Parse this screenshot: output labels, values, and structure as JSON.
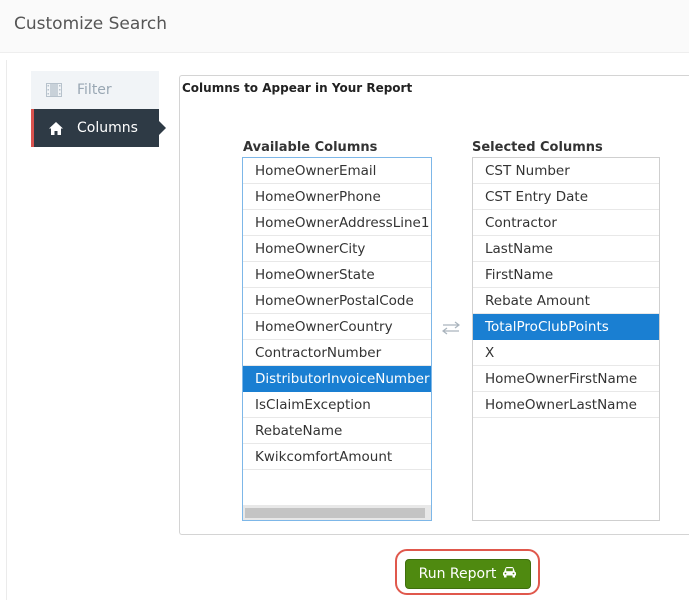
{
  "header": {
    "title": "Customize Search"
  },
  "nav": {
    "items": [
      {
        "label": "Filter",
        "icon": "film-icon",
        "active": false
      },
      {
        "label": "Columns",
        "icon": "home-icon",
        "active": true
      }
    ]
  },
  "panel": {
    "title": "Columns to Appear in Your Report",
    "available": {
      "label": "Available Columns",
      "items": [
        "HomeOwnerEmail",
        "HomeOwnerPhone",
        "HomeOwnerAddressLine1",
        "HomeOwnerCity",
        "HomeOwnerState",
        "HomeOwnerPostalCode",
        "HomeOwnerCountry",
        "ContractorNumber",
        "DistributorInvoiceNumber",
        "IsClaimException",
        "RebateName",
        "KwikcomfortAmount"
      ],
      "selected_item": "DistributorInvoiceNumber"
    },
    "selected": {
      "label": "Selected Columns",
      "items": [
        "CST Number",
        "CST Entry Date",
        "Contractor",
        "LastName",
        "FirstName",
        "Rebate Amount",
        "TotalProClubPoints",
        "X",
        "HomeOwnerFirstName",
        "HomeOwnerLastName"
      ],
      "selected_item": "TotalProClubPoints"
    },
    "swap_icon": "swap-arrows-icon"
  },
  "actions": {
    "run_label": "Run Report",
    "run_icon": "car-icon",
    "run_color": "#4f8a10",
    "highlight_color": "#e0584c"
  },
  "colors": {
    "selection": "#1a7fd2",
    "nav_active": "#2e3a45",
    "nav_active_accent": "#d9534f"
  }
}
